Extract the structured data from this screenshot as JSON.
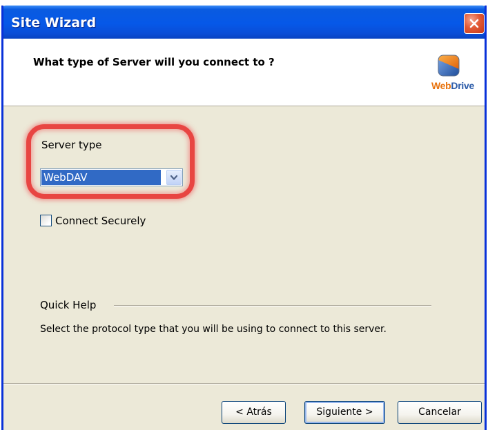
{
  "window": {
    "title": "Site Wizard",
    "close_icon": "close-icon"
  },
  "header": {
    "question": "What type of Server will you connect to ?",
    "logo": {
      "icon": "webdrive-logo-icon",
      "text_web": "Web",
      "text_drive": "Drive"
    }
  },
  "form": {
    "server_type_label": "Server type",
    "server_type_value": "WebDAV",
    "highlight_color": "#e82828",
    "connect_securely_label": "Connect Securely",
    "connect_securely_checked": false
  },
  "quick_help": {
    "heading": "Quick Help",
    "text": "Select the protocol type that you will be using to connect to this server."
  },
  "buttons": {
    "back": "< Atrás",
    "next": "Siguiente >",
    "cancel": "Cancelar"
  },
  "colors": {
    "titlebar": "#0658e8",
    "selection": "#316ac5",
    "dialog_bg": "#ece9d8"
  }
}
